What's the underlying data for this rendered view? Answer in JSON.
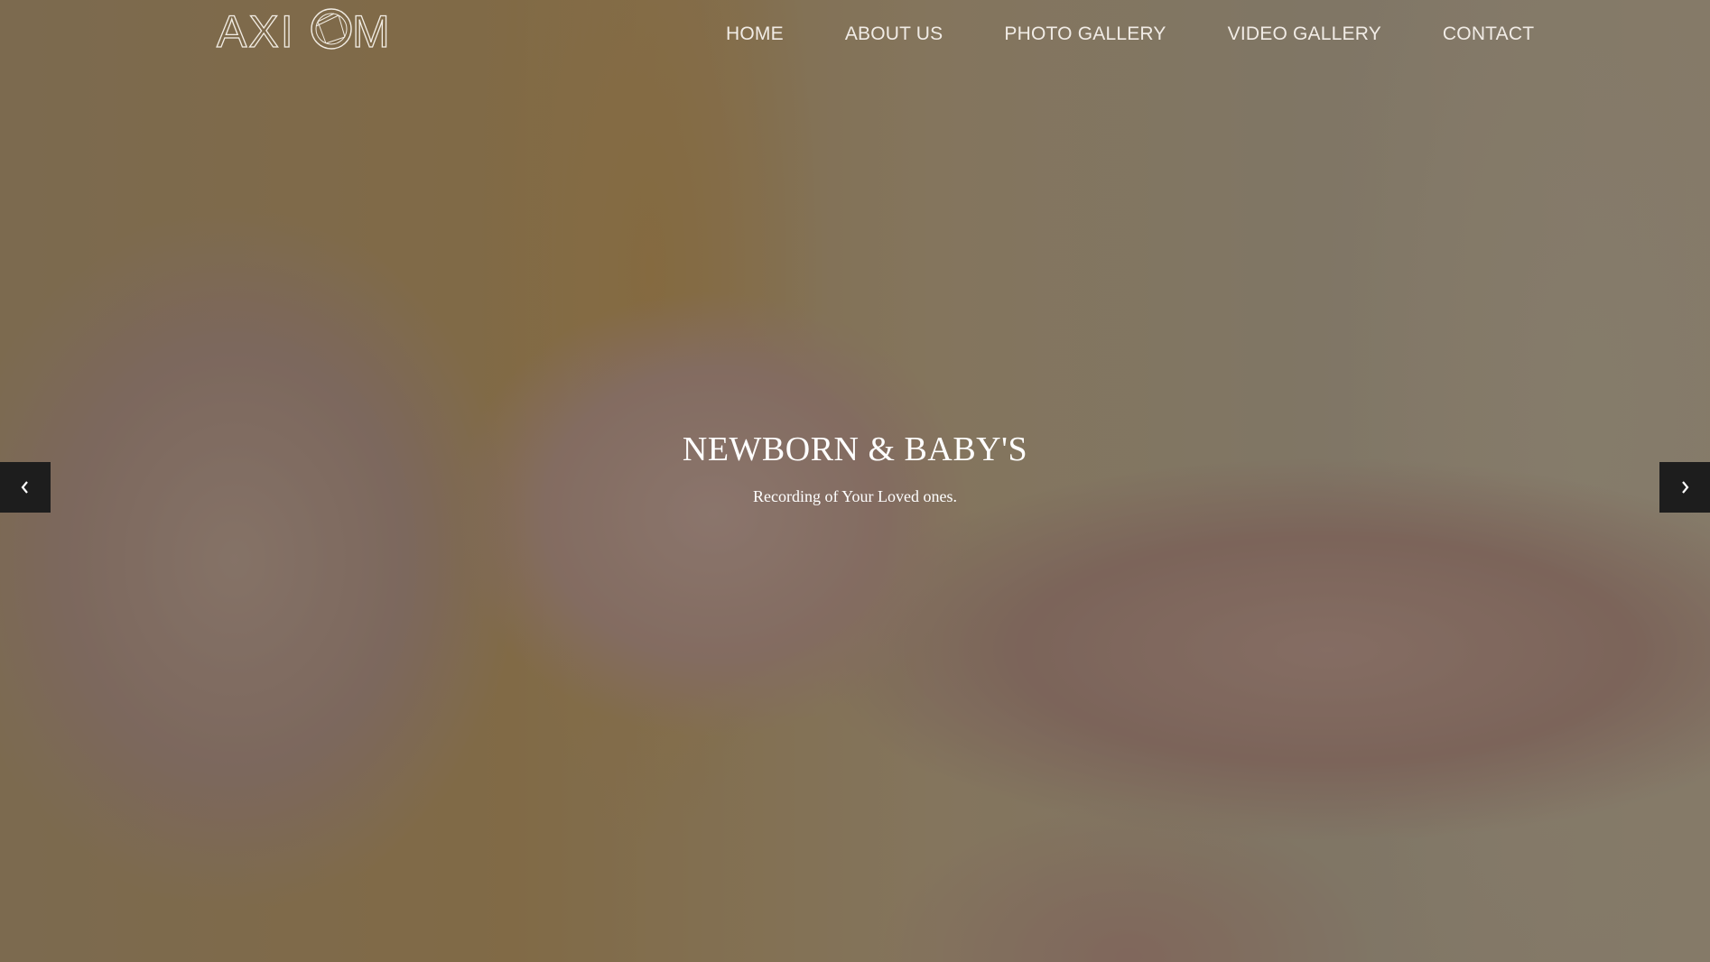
{
  "brand": {
    "logo_text": "AXIOM"
  },
  "nav": {
    "items": [
      {
        "label": "HOME"
      },
      {
        "label": "ABOUT US"
      },
      {
        "label": "PHOTO GALLERY"
      },
      {
        "label": "VIDEO GALLERY"
      },
      {
        "label": "CONTACT"
      }
    ]
  },
  "hero": {
    "title": "NEWBORN & BABY'S",
    "subtitle": "Recording of Your Loved ones.",
    "prev_icon": "chevron-left-icon",
    "next_icon": "chevron-right-icon"
  },
  "colors": {
    "overlay": "#282828",
    "nav_text": "#f1ece6",
    "arrow_bg": "#1d1d1d"
  }
}
